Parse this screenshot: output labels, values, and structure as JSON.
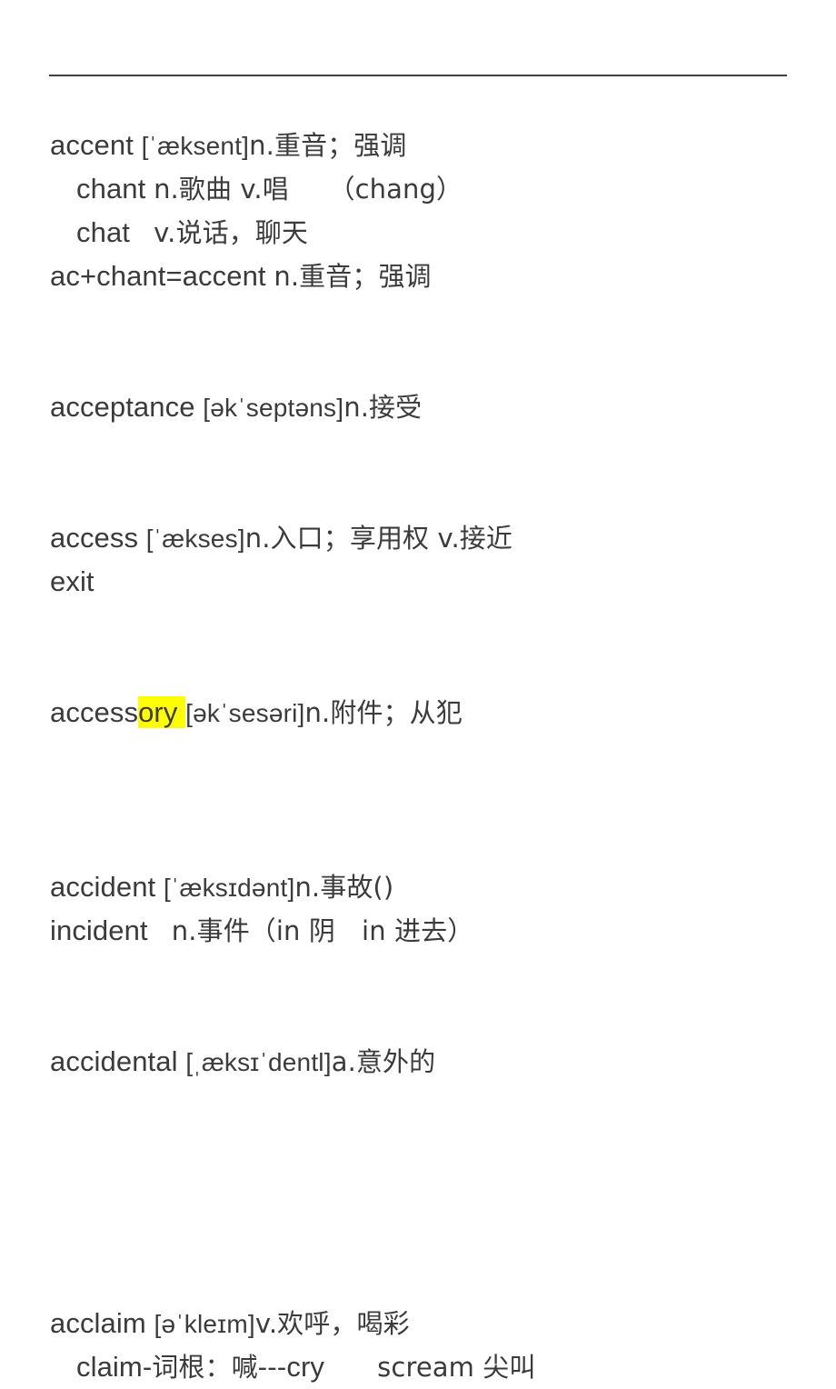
{
  "document": {
    "type": "vocabulary-notes",
    "background_color": "#ffffff",
    "text_color": "#3b3b3b",
    "highlight_color": "#ffff00",
    "rule_color": "#3f3f44",
    "lines": [
      {
        "id": "accent-headword",
        "indent": false,
        "runs": [
          {
            "kind": "word",
            "text": "accent "
          },
          {
            "kind": "phon",
            "text": "[ˈæksent]"
          },
          {
            "kind": "gloss",
            "text": "n.重音；强调"
          }
        ]
      },
      {
        "id": "chant-sub",
        "indent": true,
        "runs": [
          {
            "kind": "word",
            "text": "chant "
          },
          {
            "kind": "gloss",
            "text": "n.歌曲 v.唱"
          },
          {
            "kind": "gloss",
            "text": "　　（chang）"
          }
        ]
      },
      {
        "id": "chat-sub",
        "indent": true,
        "runs": [
          {
            "kind": "word",
            "text": "chat   "
          },
          {
            "kind": "gloss",
            "text": "v.说话，聊天"
          }
        ]
      },
      {
        "id": "accent-formula",
        "indent": false,
        "runs": [
          {
            "kind": "word",
            "text": "ac+chant=accent "
          },
          {
            "kind": "gloss",
            "text": "n.重音；强调"
          }
        ]
      },
      {
        "id": "spacer-1",
        "indent": false,
        "blank": true,
        "runs": []
      },
      {
        "id": "spacer-2",
        "indent": false,
        "blank": true,
        "runs": []
      },
      {
        "id": "acceptance-headword",
        "indent": false,
        "runs": [
          {
            "kind": "word",
            "text": "acceptance "
          },
          {
            "kind": "phon",
            "text": "[əkˈseptəns]"
          },
          {
            "kind": "gloss",
            "text": "n.接受"
          }
        ]
      },
      {
        "id": "spacer-3",
        "indent": false,
        "blank": true,
        "runs": []
      },
      {
        "id": "spacer-4",
        "indent": false,
        "blank": true,
        "runs": []
      },
      {
        "id": "access-headword",
        "indent": false,
        "runs": [
          {
            "kind": "word",
            "text": "access "
          },
          {
            "kind": "phon",
            "text": "[ˈækses]"
          },
          {
            "kind": "gloss",
            "text": "n.入口；享用权 v.接近"
          }
        ]
      },
      {
        "id": "exit-sub",
        "indent": false,
        "runs": [
          {
            "kind": "word",
            "text": "exit"
          }
        ]
      },
      {
        "id": "spacer-5",
        "indent": false,
        "blank": true,
        "runs": []
      },
      {
        "id": "spacer-6",
        "indent": false,
        "blank": true,
        "runs": []
      },
      {
        "id": "accessory-headword",
        "indent": false,
        "runs": [
          {
            "kind": "word",
            "text": "access"
          },
          {
            "kind": "word-highlight",
            "text": "ory "
          },
          {
            "kind": "phon",
            "text": "[əkˈsesəri]"
          },
          {
            "kind": "gloss",
            "text": "n.附件；从犯"
          }
        ]
      },
      {
        "id": "spacer-7",
        "indent": false,
        "blank": true,
        "runs": []
      },
      {
        "id": "spacer-8",
        "indent": false,
        "blank": true,
        "runs": []
      },
      {
        "id": "spacer-9",
        "indent": false,
        "blank": true,
        "runs": []
      },
      {
        "id": "accident-headword",
        "indent": false,
        "runs": [
          {
            "kind": "word",
            "text": "accident "
          },
          {
            "kind": "phon",
            "text": "[ˈæksɪdənt]"
          },
          {
            "kind": "gloss",
            "text": "n.事故()"
          }
        ]
      },
      {
        "id": "incident-sub",
        "indent": false,
        "runs": [
          {
            "kind": "word",
            "text": "incident   "
          },
          {
            "kind": "gloss",
            "text": "n.事件（in 阴　in 进去）"
          }
        ]
      },
      {
        "id": "spacer-10",
        "indent": false,
        "blank": true,
        "runs": []
      },
      {
        "id": "spacer-11",
        "indent": false,
        "blank": true,
        "runs": []
      },
      {
        "id": "accidental-headword",
        "indent": false,
        "runs": [
          {
            "kind": "word",
            "text": "accidental "
          },
          {
            "kind": "phon",
            "text": "[ˌæksɪˈdentl]"
          },
          {
            "kind": "gloss",
            "text": "a.意外的"
          }
        ]
      },
      {
        "id": "spacer-12",
        "indent": false,
        "blank": true,
        "runs": []
      },
      {
        "id": "spacer-13",
        "indent": false,
        "blank": true,
        "runs": []
      },
      {
        "id": "spacer-14",
        "indent": false,
        "blank": true,
        "runs": []
      },
      {
        "id": "spacer-15",
        "indent": false,
        "blank": true,
        "runs": []
      },
      {
        "id": "spacer-16",
        "indent": false,
        "blank": true,
        "runs": []
      },
      {
        "id": "acclaim-headword",
        "indent": false,
        "runs": [
          {
            "kind": "word",
            "text": "acclaim "
          },
          {
            "kind": "phon",
            "text": "[əˈkleɪm]"
          },
          {
            "kind": "gloss",
            "text": "v.欢呼，喝彩"
          }
        ]
      },
      {
        "id": "claim-root-sub",
        "indent": true,
        "runs": [
          {
            "kind": "word",
            "text": "claim-"
          },
          {
            "kind": "gloss",
            "text": "词根：喊---"
          },
          {
            "kind": "word",
            "text": "cry"
          },
          {
            "kind": "gloss",
            "text": "　　scream 尖叫"
          }
        ]
      }
    ]
  }
}
